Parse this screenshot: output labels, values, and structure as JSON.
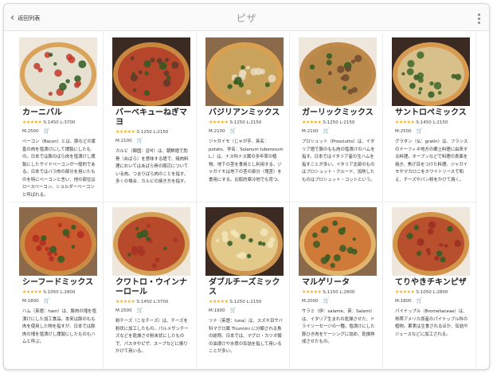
{
  "header": {
    "back_label": "返回列表",
    "title": "ピザ"
  },
  "colors": {
    "star": "#f3b11c",
    "cart": "#d23b3b"
  },
  "pizzas": [
    {
      "name": "カーニバル",
      "price_s": "S:1450",
      "price_l": "L:3700",
      "price_m": "M:2500",
      "desc": "ベーコン（Bacon）とは、豚などの家畜の肉を塩漬けにして燻製にしたもの。日本では豚のばら肉を塩漬けし燻製にしたサイドベーコンが一般的である。日本ではバラ肉の部分を用いたものを特にベーコンと言い、他の部位はロースベーコン、ショルダーベーコンと呼ばれる。",
      "name_lines": 1
    },
    {
      "name": "バーベキューねぎマヨ",
      "price_s": "S:1250",
      "price_l": "L:2150",
      "price_m": "M:2100",
      "desc": "カルビ（韓国：갈비）は、朝鮮語で肋骨（あばら）を意味する語で、焼肉料理においてはあばら骨の周辺についている肉。つまりばら肉のことを指す。多くの場合、カルビの焼き方を指す。",
      "name_lines": 2
    },
    {
      "name": "バジリアンミックス",
      "price_s": "S:1250",
      "price_l": "L:2150",
      "price_m": "M:2100",
      "desc": "ジャガイモ（じゃが芋、英名：potato、学名：Solanum tuberosum L.）は、ナス科ナス属の多年草の植物。地下の茎を食用とし利用する。ジャガイモは地下の茎の部分（塊茎）を食用にする。比較的寒冷地でも育つ。",
      "name_lines": 1
    },
    {
      "name": "ガーリックミックス",
      "price_s": "S:1250",
      "price_l": "L:2150",
      "price_m": "M:2100",
      "desc": "プロシュット（Prosciutto）は、イタリア語で豚のもも肉の塩漬けのハムを指す。日本ではイタリア産の生ハムを指すことが多い。イタリア北部のものはプロシュット・クルード、加熱したものはプロシュット・コットという。",
      "name_lines": 1
    },
    {
      "name": "サントロペミックス",
      "price_s": "S:1450",
      "price_l": "L:2150",
      "price_m": "M:2500",
      "desc": "グラタン（仏：gratin）は、フランスのドーフィネ地方の郷土料理に由来する料理。オーブンなどで料理の表面を焼き、焦げ目をつけた料理。ジャガイモやマカロニをホワイトソースで和え、チーズやパン粉をかけて焼く。",
      "name_lines": 1
    },
    {
      "name": "シーフードミックス",
      "price_s": "S:1050",
      "price_l": "L:2800",
      "price_m": "M:1800",
      "desc": "ハム（英語：ham）は、豚肉の塊を塩漬けにした加工食品。本来は豚のもも肉を使用した物を指すが、日本では豚肉の塊を塩漬けし燻製にしたものもハムと呼ぶ。",
      "name_lines": 1
    },
    {
      "name": "クワトロ・ウインナーロール",
      "price_s": "S:1450",
      "price_l": "L:3700",
      "price_m": "M:2500",
      "desc": "粉チーズ（こなチーズ）は、チーズを粉状に加工したもの。パルメザンチーズなどを乾燥させ粉末状にしたもので、パスタやピザ、スープなどに振りかけて用いる。",
      "name_lines": 2
    },
    {
      "name": "ダブルチーズミックス",
      "price_s": "S:1250",
      "price_l": "L:2150",
      "price_m": "M:1900",
      "desc": "ツナ（英語：tuna）は、スズキ目サバ科マグロ属 Thunnini に分類される魚の総称。日本では、マグロ・カツオ類の油漬けや水煮の缶詰を指して用いることが多い。",
      "name_lines": 2
    },
    {
      "name": "マルゲリータ",
      "price_s": "S:1150",
      "price_l": "L:2800",
      "price_m": "M:2000",
      "desc": "サラミ（伊：salame、英：Salami）は、イタリア生まれの乾燥させた、ドライソーセージの一種。塩漬けにした豚ひき肉をケーシングに詰め、乾燥熟成させたもの。",
      "name_lines": 1
    },
    {
      "name": "てりやきチキンピザ",
      "price_s": "S:1050",
      "price_l": "L:2800",
      "price_m": "M:1800",
      "desc": "パイナップル（Bromeliaceae）は、熱帯アメリカ原産のパイナップル科の植物。果実は生食されるほか、缶詰やジュースなどに加工される。",
      "name_lines": 1
    }
  ]
}
